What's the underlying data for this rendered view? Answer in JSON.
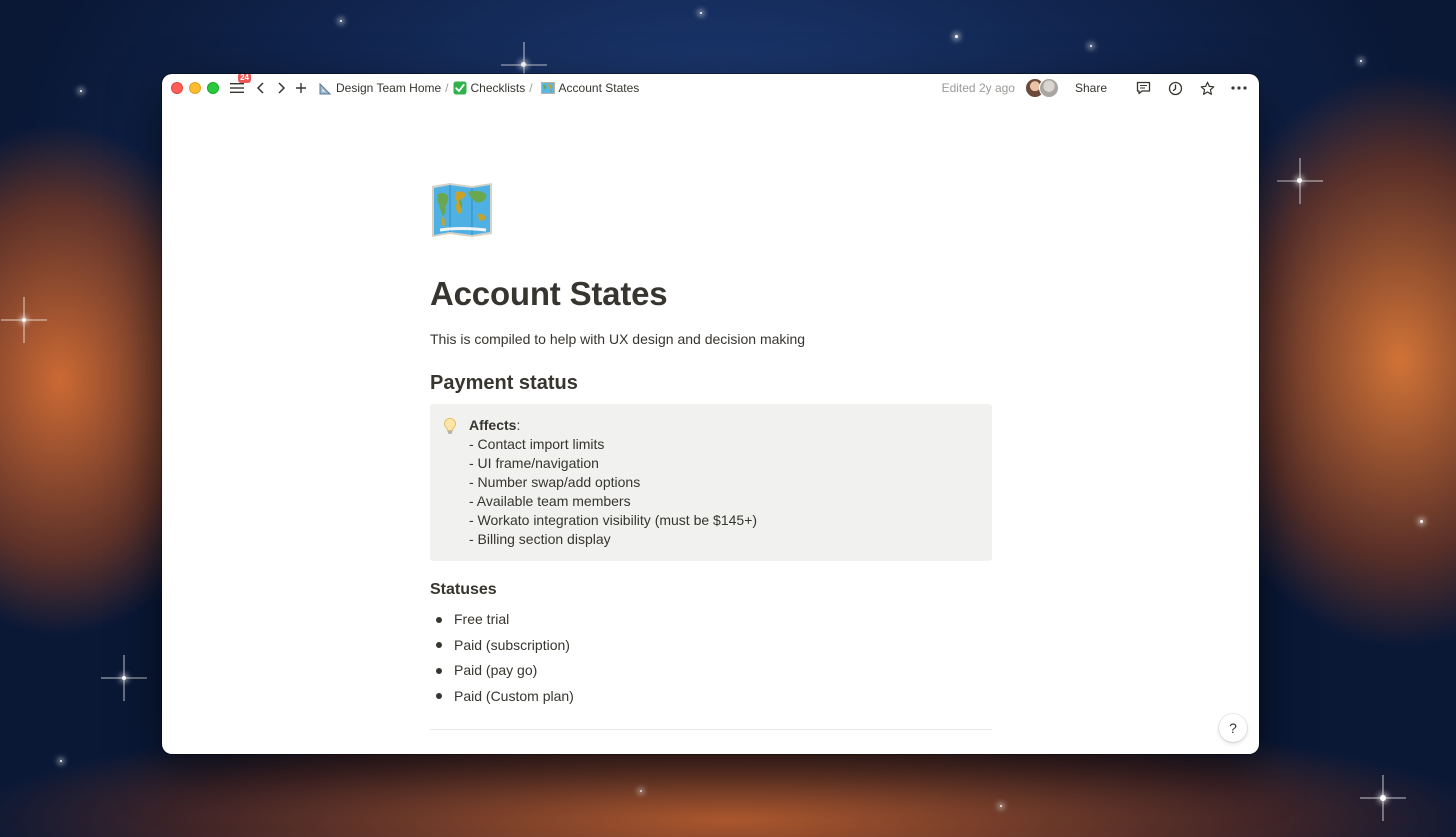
{
  "topbar": {
    "sidebar_badge": "24",
    "breadcrumbs": [
      {
        "icon": "triangle-ruler-icon",
        "label": "Design Team Home"
      },
      {
        "icon": "green-check-icon",
        "label": "Checklists"
      },
      {
        "icon": "world-map-icon",
        "label": "Account States"
      }
    ],
    "separator": "/",
    "edited": "Edited 2y ago",
    "share_label": "Share",
    "icons": [
      "comment-icon",
      "history-clock-icon",
      "star-icon",
      "more-dots-icon"
    ]
  },
  "page": {
    "icon": "world-map-icon",
    "title": "Account States",
    "subtitle": "This is compiled to help with UX design and decision making",
    "sections": [
      {
        "heading": "Payment status",
        "callout": {
          "icon": "lightbulb-icon",
          "heading": "Affects",
          "heading_suffix": ":",
          "lines": [
            "- Contact import limits",
            "- UI frame/navigation",
            "- Number swap/add options",
            "- Available team members",
            "- Workato integration visibility (must be $145+)",
            "- Billing section display"
          ]
        }
      }
    ],
    "statuses": {
      "heading": "Statuses",
      "items": [
        "Free trial",
        "Paid (subscription)",
        "Paid (pay go)",
        "Paid (Custom plan)"
      ]
    }
  },
  "help": {
    "label": "?"
  },
  "colors": {
    "text": "#37352f",
    "muted": "#9b9a97",
    "callout_bg": "#f1f1ef",
    "badge": "#eb5757"
  }
}
